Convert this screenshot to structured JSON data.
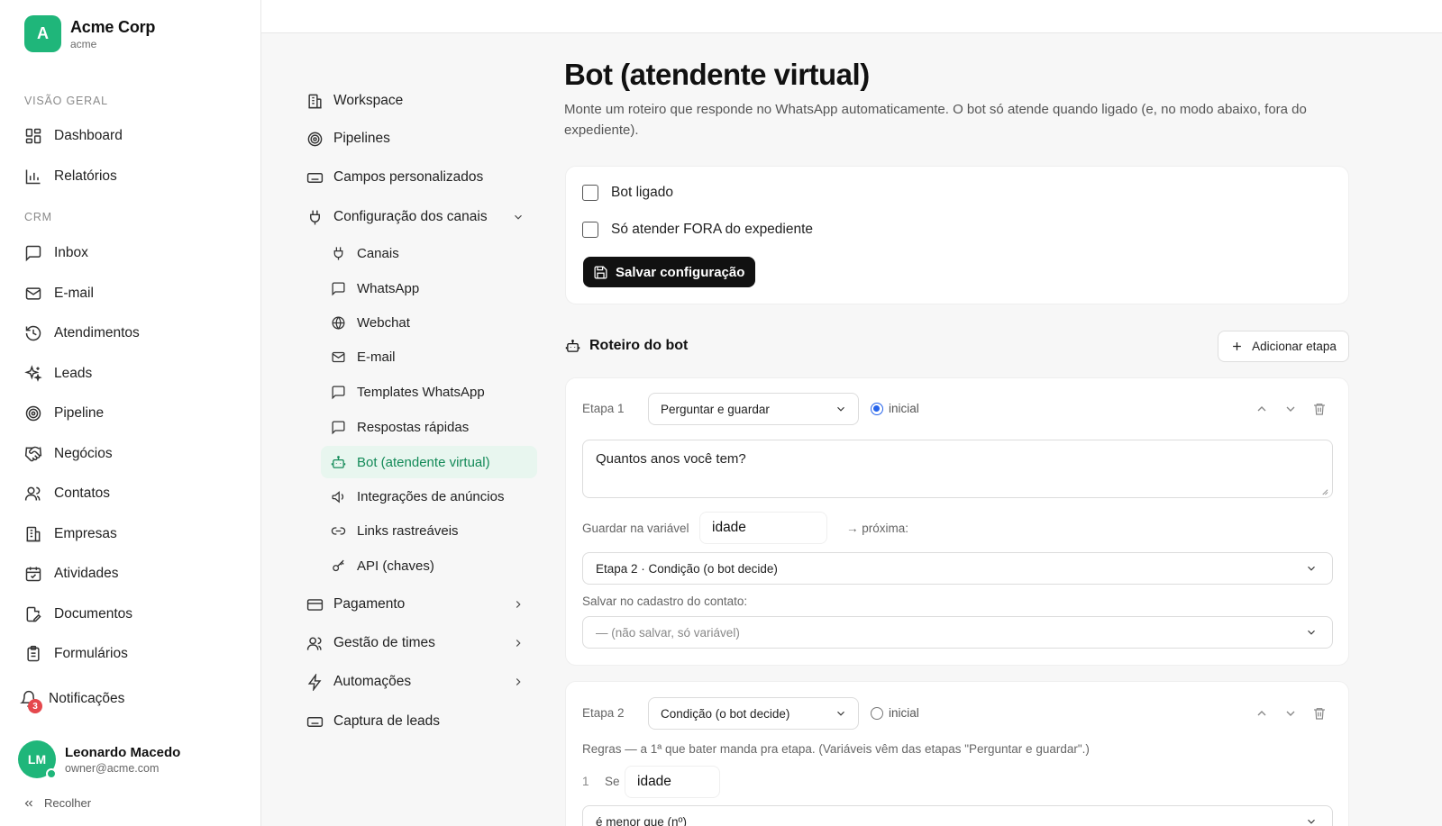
{
  "brand": {
    "initial": "A",
    "name": "Acme Corp",
    "slug": "acme"
  },
  "sidebar": {
    "sections": {
      "overview": "VISÃO GERAL",
      "crm": "CRM"
    },
    "items": [
      {
        "label": "Dashboard",
        "icon": "dashboard-icon"
      },
      {
        "label": "Relatórios",
        "icon": "bar-chart-icon"
      },
      {
        "label": "Inbox",
        "icon": "message-icon"
      },
      {
        "label": "E-mail",
        "icon": "mail-icon"
      },
      {
        "label": "Atendimentos",
        "icon": "history-icon"
      },
      {
        "label": "Leads",
        "icon": "sparkles-icon"
      },
      {
        "label": "Pipeline",
        "icon": "target-icon"
      },
      {
        "label": "Negócios",
        "icon": "handshake-icon"
      },
      {
        "label": "Contatos",
        "icon": "users-icon"
      },
      {
        "label": "Empresas",
        "icon": "building-icon"
      },
      {
        "label": "Atividades",
        "icon": "calendar-check-icon"
      },
      {
        "label": "Documentos",
        "icon": "file-signature-icon"
      },
      {
        "label": "Formulários",
        "icon": "clipboard-icon"
      }
    ],
    "notifications": {
      "label": "Notificações",
      "count": "3"
    },
    "user": {
      "initials": "LM",
      "name": "Leonardo Macedo",
      "email": "owner@acme.com"
    },
    "collapse_label": "Recolher"
  },
  "settings_menu": {
    "items": [
      {
        "label": "Workspace"
      },
      {
        "label": "Pipelines"
      },
      {
        "label": "Campos personalizados"
      },
      {
        "label": "Configuração dos canais"
      },
      {
        "label": "Pagamento"
      },
      {
        "label": "Gestão de times"
      },
      {
        "label": "Automações"
      },
      {
        "label": "Captura de leads"
      }
    ],
    "channel_children": [
      {
        "label": "Canais"
      },
      {
        "label": "WhatsApp"
      },
      {
        "label": "Webchat"
      },
      {
        "label": "E-mail"
      },
      {
        "label": "Templates WhatsApp"
      },
      {
        "label": "Respostas rápidas"
      },
      {
        "label": "Bot (atendente virtual)"
      },
      {
        "label": "Integrações de anúncios"
      },
      {
        "label": "Links rastreáveis"
      },
      {
        "label": "API (chaves)"
      }
    ]
  },
  "page": {
    "title": "Bot (atendente virtual)",
    "description": "Monte um roteiro que responde no WhatsApp automaticamente. O bot só atende quando ligado (e, no modo abaixo, fora do expediente)."
  },
  "config": {
    "bot_on_label": "Bot ligado",
    "off_hours_label": "Só atender FORA do expediente",
    "save_label": "Salvar configuração"
  },
  "script": {
    "title": "Roteiro do bot",
    "add_step_label": "Adicionar etapa",
    "steps": [
      {
        "label": "Etapa 1",
        "type": "Perguntar e guardar",
        "initial_label": "inicial",
        "message": "Quantos anos você tem?",
        "var_label": "Guardar na variável",
        "var_value": "idade",
        "next_label": "→ próxima:",
        "next_value": "Etapa 2 · Condição (o bot decide)",
        "save_field_label": "Salvar no cadastro do contato:",
        "save_field_value": "— (não salvar, só variável)"
      },
      {
        "label": "Etapa 2",
        "type": "Condição (o bot decide)",
        "initial_label": "inicial",
        "rules_hint": "Regras — a 1ª que bater manda pra etapa. (Variáveis vêm das etapas \"Perguntar e guardar\".)",
        "rule_index": "1",
        "rule_if": "Se",
        "rule_var": "idade",
        "rule_operator": "é menor que (nº)"
      }
    ]
  }
}
